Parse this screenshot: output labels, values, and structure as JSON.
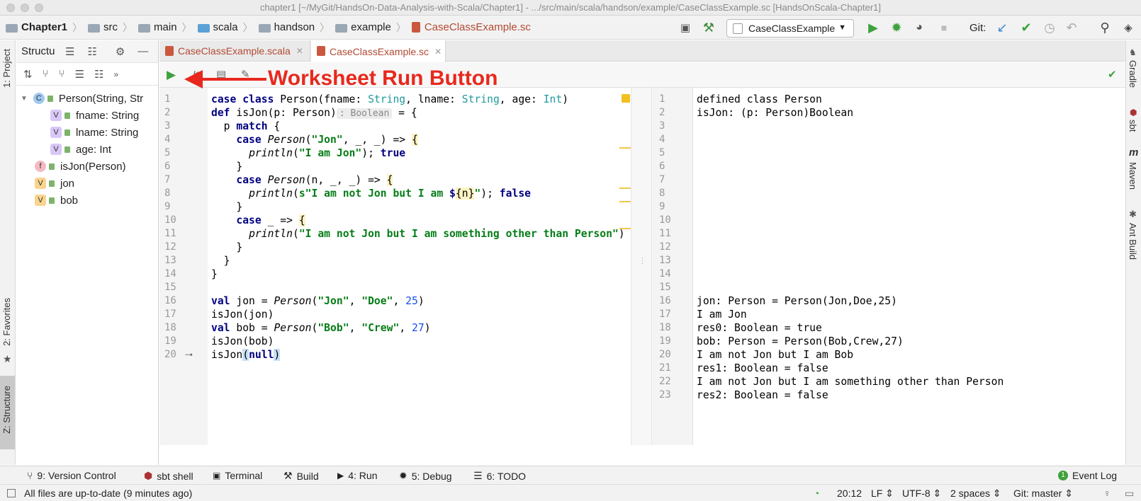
{
  "window": {
    "title": "chapter1 [~/MyGit/HandsOn-Data-Analysis-with-Scala/Chapter1] - .../src/main/scala/handson/example/CaseClassExample.sc [HandsOnScala-Chapter1]"
  },
  "breadcrumb": [
    "Chapter1",
    "src",
    "main",
    "scala",
    "handson",
    "example",
    "CaseClassExample.sc"
  ],
  "toolbar": {
    "run_config": "CaseClassExample",
    "git_label": "Git:"
  },
  "left_strip": {
    "project": "1: Project",
    "favorites": "2: Favorites",
    "structure": "Z: Structure"
  },
  "right_strip": {
    "gradle": "Gradle",
    "sbt": "sbt",
    "maven": "Maven",
    "ant": "Ant Build"
  },
  "structure": {
    "title": "Structu",
    "items": [
      {
        "badge": "C",
        "label": "Person(String, Str"
      },
      {
        "badge": "V",
        "label": "fname: String"
      },
      {
        "badge": "V",
        "label": "lname: String"
      },
      {
        "badge": "V",
        "label": "age: Int"
      },
      {
        "badge": "f",
        "label": "isJon(Person)"
      },
      {
        "badge": "V",
        "label": "jon"
      },
      {
        "badge": "V",
        "label": "bob"
      }
    ]
  },
  "tabs": [
    {
      "label": "CaseClassExample.scala"
    },
    {
      "label": "CaseClassExample.sc"
    }
  ],
  "annotation": {
    "text": "Worksheet Run Button"
  },
  "editor": {
    "line_numbers": [
      "1",
      "2",
      "3",
      "4",
      "5",
      "6",
      "7",
      "8",
      "9",
      "10",
      "11",
      "12",
      "13",
      "14",
      "15",
      "16",
      "17",
      "18",
      "19",
      "20"
    ],
    "hint": ": Boolean"
  },
  "output": {
    "line_numbers": [
      "1",
      "2",
      "3",
      "4",
      "5",
      "6",
      "7",
      "8",
      "9",
      "10",
      "11",
      "12",
      "13",
      "14",
      "15",
      "16",
      "17",
      "18",
      "19",
      "20",
      "21",
      "22",
      "23"
    ],
    "lines": [
      "defined class Person",
      "isJon: (p: Person)Boolean",
      "",
      "",
      "",
      "",
      "",
      "",
      "",
      "",
      "",
      "",
      "",
      "",
      "",
      "jon: Person = Person(Jon,Doe,25)",
      "I am Jon",
      "res0: Boolean = true",
      "bob: Person = Person(Bob,Crew,27)",
      "I am not Jon but I am Bob",
      "res1: Boolean = false",
      "I am not Jon but I am something other than Person",
      "res2: Boolean = false"
    ]
  },
  "tool_windows": [
    {
      "label": "9: Version Control"
    },
    {
      "label": "sbt shell"
    },
    {
      "label": "Terminal"
    },
    {
      "label": "Build"
    },
    {
      "label": "4: Run"
    },
    {
      "label": "5: Debug"
    },
    {
      "label": "6: TODO"
    }
  ],
  "event_log": "Event Log",
  "status": {
    "message": "All files are up-to-date (9 minutes ago)",
    "position": "20:12",
    "line_sep": "LF",
    "encoding": "UTF-8",
    "indent": "2 spaces",
    "branch": "Git: master"
  }
}
